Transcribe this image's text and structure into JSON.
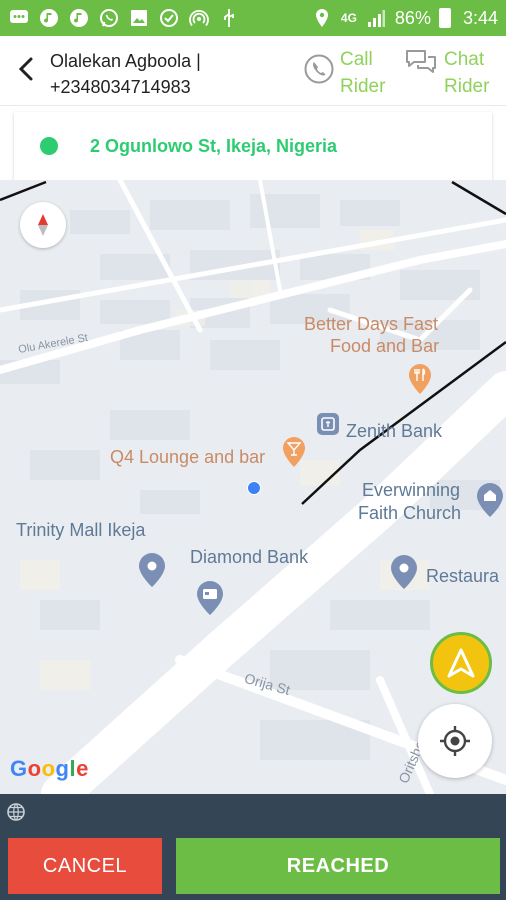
{
  "status_bar": {
    "battery": "86%",
    "time": "3:44",
    "network": "4G",
    "icons": [
      "messages-icon",
      "music-icon",
      "music-icon",
      "whatsapp-icon",
      "image-icon",
      "check-icon",
      "hotspot-icon",
      "usb-icon",
      "location-icon",
      "signal-icon",
      "battery-icon"
    ]
  },
  "header": {
    "rider_line1": "Olalekan Agboola |",
    "rider_line2": "+2348034714983",
    "call_label_1": "Call",
    "call_label_2": "Rider",
    "chat_label_1": "Chat",
    "chat_label_2": "Rider"
  },
  "address": {
    "text": "2 Ogunlowo St, Ikeja, Nigeria"
  },
  "map": {
    "places": {
      "better_days_1": "Better Days Fast",
      "better_days_2": "Food and Bar",
      "zenith": "Zenith Bank",
      "q4": "Q4 Lounge and bar",
      "everwinning_1": "Everwinning",
      "everwinning_2": "Faith Church",
      "trinity": "Trinity Mall Ikeja",
      "diamond": "Diamond Bank",
      "restaurant": "Restaura",
      "olu_akerele": "Olu Akerele St",
      "orija": "Orija St",
      "oritshe": "Oritshe St"
    },
    "attribution": [
      "G",
      "o",
      "o",
      "g",
      "l",
      "e"
    ]
  },
  "colors": {
    "accent_green": "#6cbd45",
    "address_green": "#2ecc71",
    "cancel_red": "#e74c3c",
    "bottom_bar": "#344556"
  },
  "actions": {
    "cancel": "CANCEL",
    "reached": "REACHED"
  }
}
